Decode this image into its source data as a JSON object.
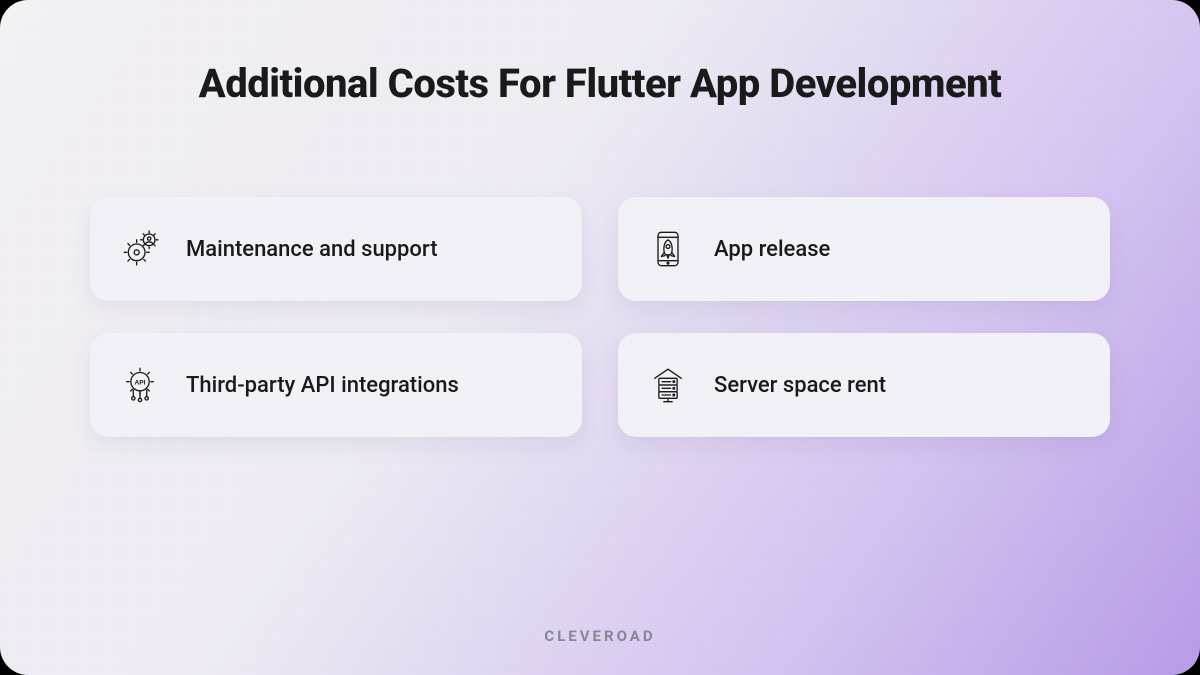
{
  "title": "Additional Costs For Flutter App Development",
  "cards": [
    {
      "label": "Maintenance and support",
      "icon": "maintenance-icon"
    },
    {
      "label": "App release",
      "icon": "app-release-icon"
    },
    {
      "label": "Third-party API integrations",
      "icon": "api-icon"
    },
    {
      "label": "Server space rent",
      "icon": "server-icon"
    }
  ],
  "footer": "CLEVEROAD"
}
